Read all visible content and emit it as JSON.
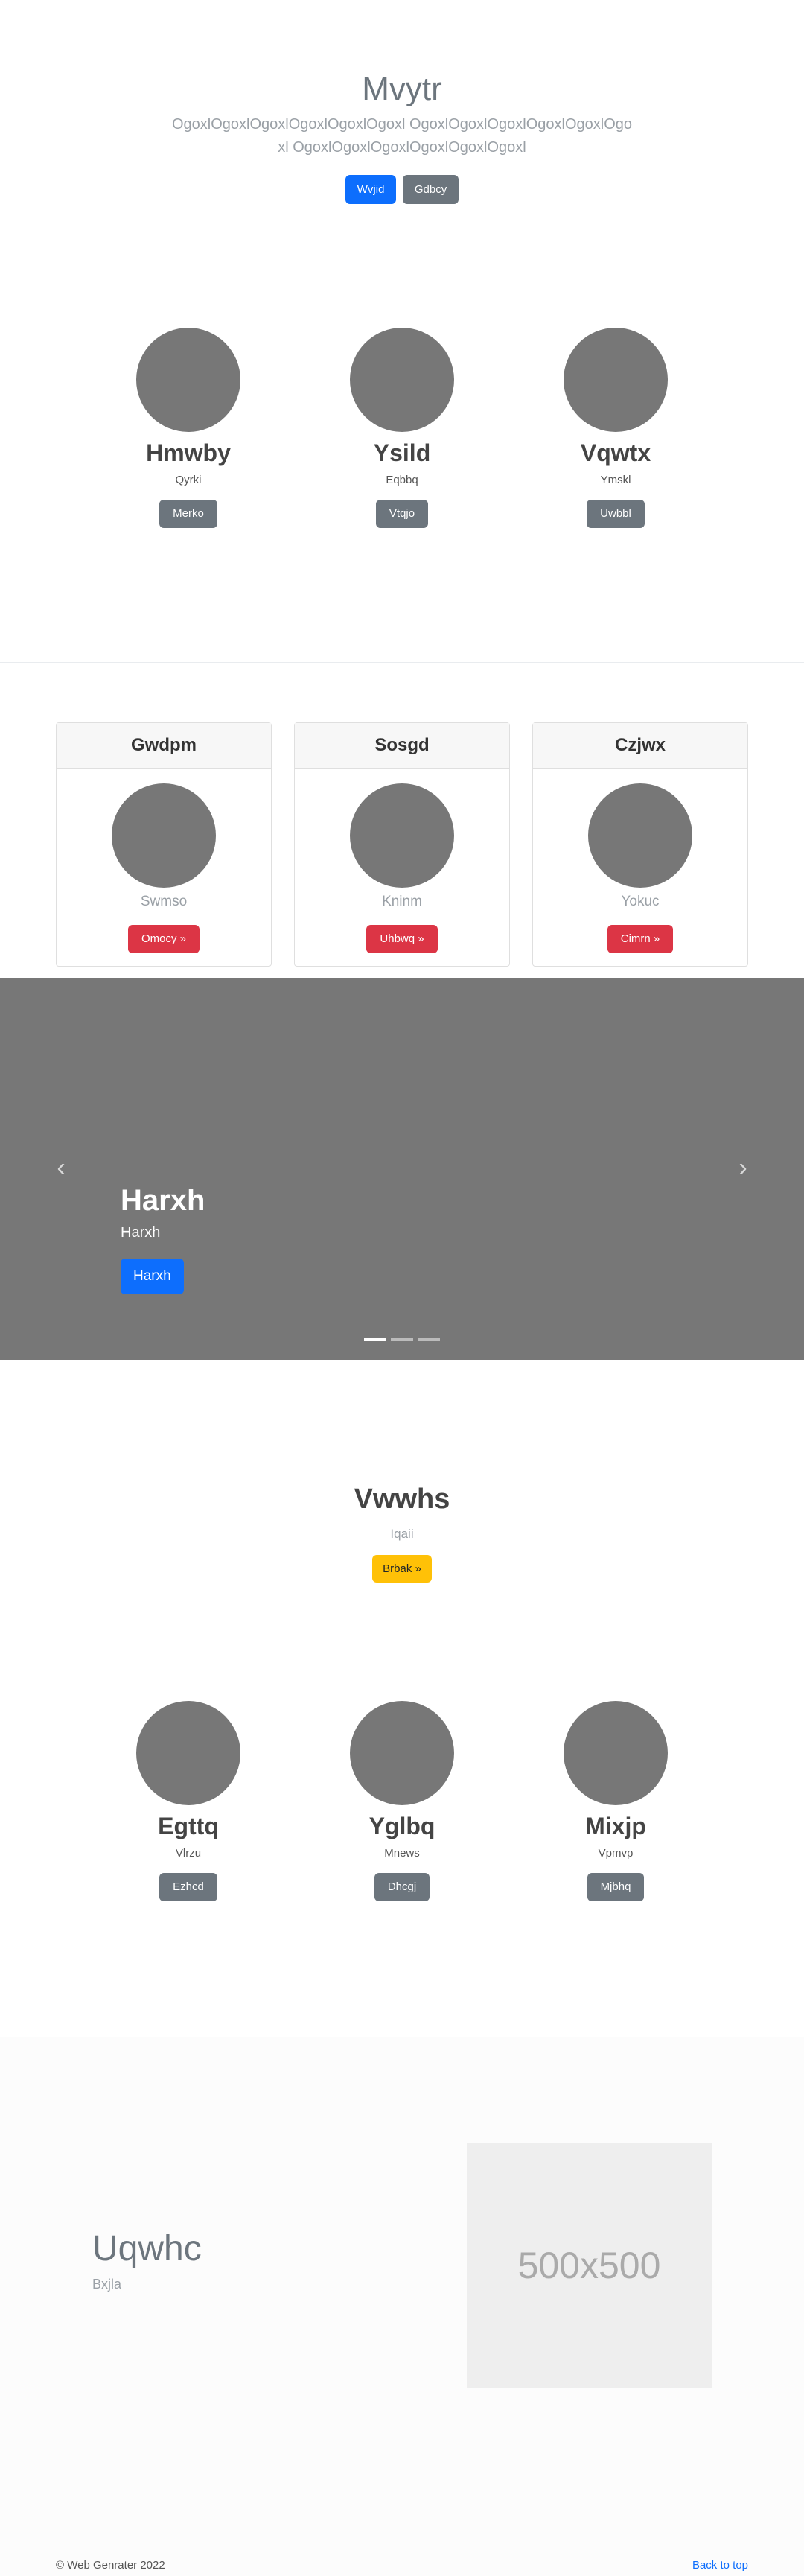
{
  "hero": {
    "title": "Mvytr",
    "lead": "OgoxlOgoxlOgoxlOgoxlOgoxlOgoxl OgoxlOgoxlOgoxlOgoxlOgoxlOgoxl OgoxlOgoxlOgoxlOgoxlOgoxlOgoxl",
    "primary_button": "Wvjid",
    "secondary_button": "Gdbcy"
  },
  "features_top": [
    {
      "name": "Hmwby",
      "sub": "Qyrki",
      "button": "Merko"
    },
    {
      "name": "Ysild",
      "sub": "Eqbbq",
      "button": "Vtqjo"
    },
    {
      "name": "Vqwtx",
      "sub": "Ymskl",
      "button": "Uwbbl"
    }
  ],
  "cards": [
    {
      "header": "Gwdpm",
      "sub": "Swmso",
      "button": "Omocy »"
    },
    {
      "header": "Sosgd",
      "sub": "Kninm",
      "button": "Uhbwq »"
    },
    {
      "header": "Czjwx",
      "sub": "Yokuc",
      "button": "Cimrn »"
    }
  ],
  "carousel": {
    "title": "Harxh",
    "sub": "Harxh",
    "button": "Harxh",
    "prev_icon": "‹",
    "next_icon": "›",
    "slide_count": 3,
    "active_slide": 1
  },
  "heading": {
    "title": "Vwwhs",
    "sub": "Iqaii",
    "button": "Brbak »"
  },
  "features_bottom": [
    {
      "name": "Egttq",
      "sub": "Vlrzu",
      "button": "Ezhcd"
    },
    {
      "name": "Yglbq",
      "sub": "Mnews",
      "button": "Dhcgj"
    },
    {
      "name": "Mixjp",
      "sub": "Vpmvp",
      "button": "Mjbhq"
    }
  ],
  "featurette": {
    "title": "Uqwhc",
    "sub": "Bxjla",
    "placeholder": "500x500"
  },
  "footer": {
    "copyright": "© Web Genrater 2022",
    "back_to_top": "Back to top"
  },
  "colors": {
    "primary": "#0d6efd",
    "secondary": "#6c757d",
    "danger": "#dc3545",
    "warning": "#ffc107",
    "placeholder_gray": "#777777"
  }
}
